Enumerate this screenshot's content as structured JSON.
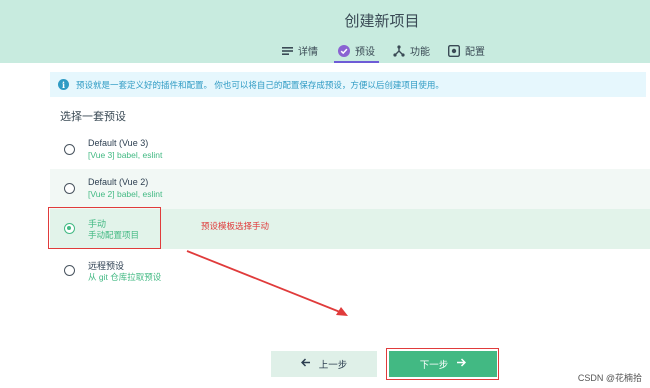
{
  "header": {
    "title": "创建新项目",
    "tabs": [
      {
        "label": "详情",
        "icon": "list-icon"
      },
      {
        "label": "预设",
        "icon": "check-circle-icon",
        "active": true
      },
      {
        "label": "功能",
        "icon": "fork-icon"
      },
      {
        "label": "配置",
        "icon": "settings-box-icon"
      }
    ]
  },
  "info": {
    "icon": "info-icon",
    "text": "预设就是一套定义好的插件和配置。 你也可以将自己的配置保存成预设，方便以后创建项目使用。"
  },
  "section_title": "选择一套预设",
  "presets": [
    {
      "name": "Default (Vue 3)",
      "desc": "[Vue 3] babel, eslint",
      "selected": false
    },
    {
      "name": "Default (Vue 2)",
      "desc": "[Vue 2] babel, eslint",
      "selected": false
    },
    {
      "name": "手动",
      "desc": "手动配置项目",
      "selected": true
    },
    {
      "name": "远程预设",
      "desc": "从 git 仓库拉取预设",
      "selected": false
    }
  ],
  "annotation": "预设模板选择手动",
  "buttons": {
    "prev": "上一步",
    "next": "下一步"
  },
  "watermark": "CSDN @花楠拾",
  "colors": {
    "accent": "#42b983",
    "header_bg": "#c8ebdf",
    "annotation": "#e03b3b",
    "info": "#2f9bc4",
    "tab_underline": "#6e5bd6"
  }
}
